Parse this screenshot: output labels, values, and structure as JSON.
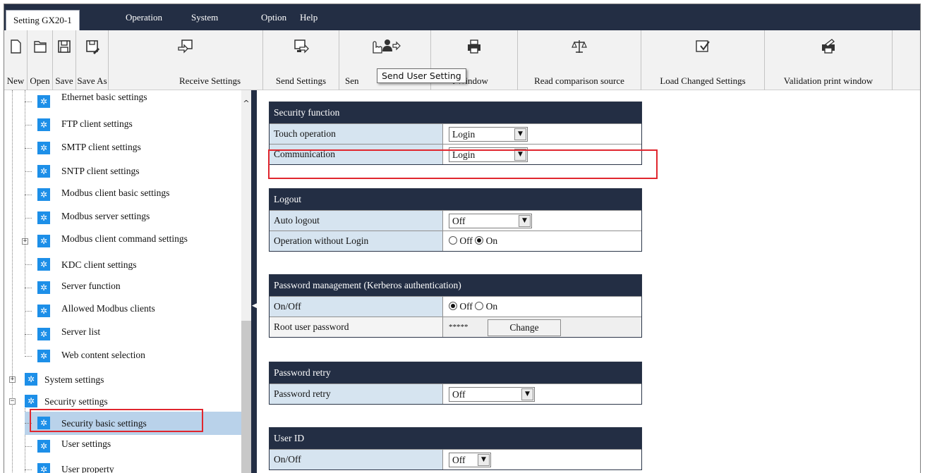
{
  "menubar": {
    "tab_active": "Setting GX20-1",
    "items": [
      "Operation",
      "System",
      "Option",
      "Help"
    ]
  },
  "toolbar": {
    "buttons": [
      {
        "label": "New",
        "icon": "new-file-icon"
      },
      {
        "label": "Open",
        "icon": "open-folder-icon"
      },
      {
        "label": "Save",
        "icon": "save-icon"
      },
      {
        "label": "Save As",
        "icon": "save-as-icon"
      },
      {
        "label": "Receive Settings",
        "icon": "receive-settings-icon"
      },
      {
        "label": "Send Settings",
        "icon": "send-settings-icon"
      },
      {
        "label": "Sen",
        "icon": "send-user-setting-icon"
      },
      {
        "label": "t Window",
        "icon": "print-icon"
      },
      {
        "label": "Read comparison source",
        "icon": "scales-icon"
      },
      {
        "label": "Load Changed Settings",
        "icon": "load-changed-icon"
      },
      {
        "label": "Validation print window",
        "icon": "validation-print-icon"
      }
    ],
    "tooltip": "Send User Setting"
  },
  "tree": {
    "items": [
      {
        "label": "Ethernet basic settings"
      },
      {
        "label": "FTP client settings"
      },
      {
        "label": "SMTP client settings"
      },
      {
        "label": "SNTP client settings"
      },
      {
        "label": "Modbus client basic settings"
      },
      {
        "label": "Modbus server settings"
      },
      {
        "label": "Modbus client command settings"
      },
      {
        "label": "KDC client settings"
      },
      {
        "label": "Server function"
      },
      {
        "label": "Allowed Modbus clients"
      },
      {
        "label": "Server list"
      },
      {
        "label": "Web content selection"
      },
      {
        "label": "System settings"
      },
      {
        "label": "Security settings"
      },
      {
        "label": "Security basic settings",
        "selected": true
      },
      {
        "label": "User settings"
      },
      {
        "label": "User property"
      }
    ]
  },
  "sections": {
    "security_function": {
      "title": "Security function",
      "touch_operation": {
        "label": "Touch operation",
        "value": "Login"
      },
      "communication": {
        "label": "Communication",
        "value": "Login"
      }
    },
    "logout": {
      "title": "Logout",
      "auto_logout": {
        "label": "Auto logout",
        "value": "Off"
      },
      "operation_without_login": {
        "label": "Operation without Login",
        "opt_off": "Off",
        "opt_on": "On",
        "selected": "On"
      }
    },
    "password_management": {
      "title": "Password management (Kerberos authentication)",
      "on_off": {
        "label": "On/Off",
        "opt_off": "Off",
        "opt_on": "On",
        "selected": "Off"
      },
      "root_password": {
        "label": "Root user password",
        "mask": "*****",
        "button": "Change"
      }
    },
    "password_retry": {
      "title": "Password retry",
      "retry": {
        "label": "Password retry",
        "value": "Off"
      }
    },
    "user_id": {
      "title": "User ID",
      "on_off": {
        "label": "On/Off",
        "value": "Off"
      }
    }
  },
  "colors": {
    "header": "#232e44",
    "label_bg": "#d6e4f0",
    "highlight": "#e0262e",
    "tree_icon": "#1d8fe8"
  }
}
